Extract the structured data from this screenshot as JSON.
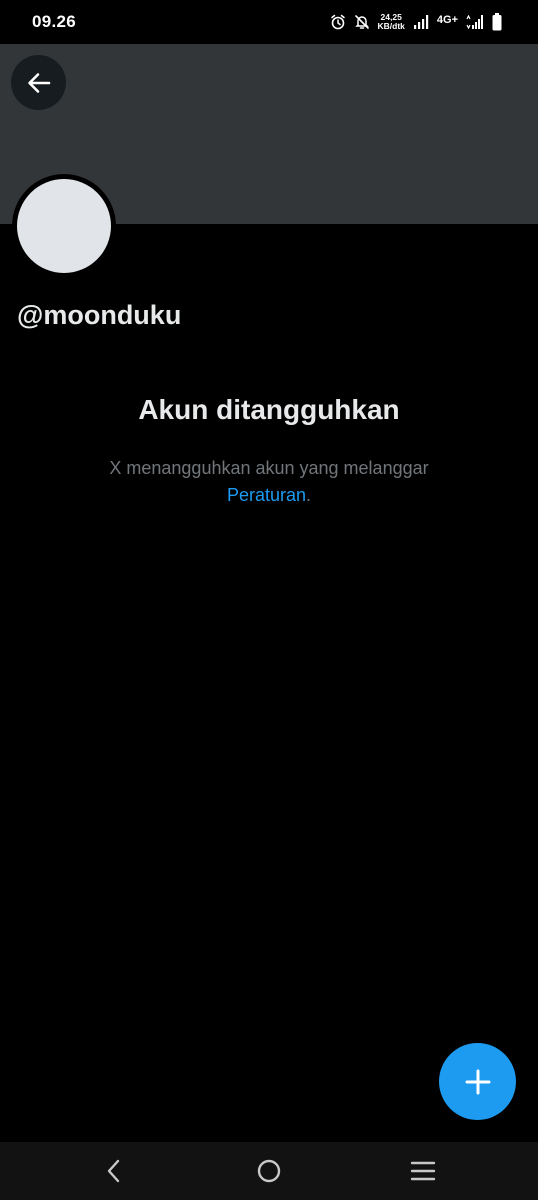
{
  "status_bar": {
    "time": "09.26",
    "speed_value": "24,25",
    "speed_unit": "KB/dtk",
    "network": "4G+",
    "icons": [
      "alarm-icon",
      "mute-icon",
      "signal-icon",
      "signal-icon",
      "battery-icon"
    ]
  },
  "profile": {
    "handle": "@moonduku"
  },
  "suspended": {
    "title": "Akun ditangguhkan",
    "message": "X menangguhkan akun yang melanggar ",
    "link_text": "Peraturan",
    "suffix": "."
  },
  "colors": {
    "background": "#000000",
    "banner": "#333639",
    "accent": "#1d9bf0",
    "secondary_text": "#71767b"
  }
}
